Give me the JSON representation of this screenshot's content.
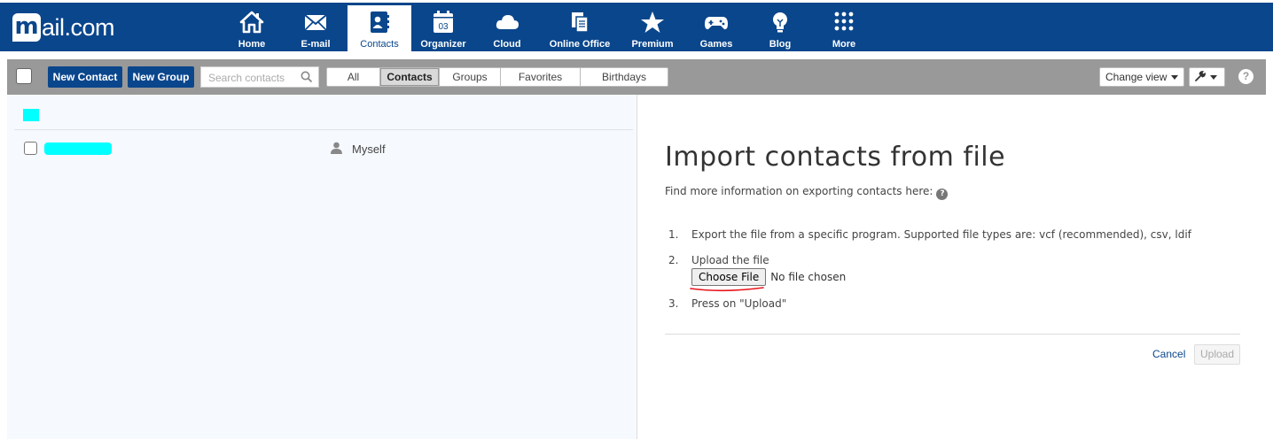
{
  "brand": {
    "logo_letter": "m",
    "logo_text": "ail.com"
  },
  "nav": [
    {
      "label": "Home",
      "icon": "home-icon"
    },
    {
      "label": "E-mail",
      "icon": "mail-icon"
    },
    {
      "label": "Contacts",
      "icon": "contacts-icon",
      "active": true
    },
    {
      "label": "Organizer",
      "icon": "calendar-icon",
      "badge": "03"
    },
    {
      "label": "Cloud",
      "icon": "cloud-icon"
    },
    {
      "label": "Online Office",
      "icon": "office-icon"
    },
    {
      "label": "Premium",
      "icon": "star-icon"
    },
    {
      "label": "Games",
      "icon": "gamepad-icon"
    },
    {
      "label": "Blog",
      "icon": "lightbulb-icon"
    },
    {
      "label": "More",
      "icon": "grid-icon"
    }
  ],
  "toolbar": {
    "new_contact": "New Contact",
    "new_group": "New Group",
    "search_placeholder": "Search contacts",
    "filters": [
      "All",
      "Contacts",
      "Groups",
      "Favorites",
      "Birthdays"
    ],
    "active_filter": "Contacts",
    "change_view": "Change view",
    "help": "?"
  },
  "contact_list": {
    "rows": [
      {
        "tag": "Myself"
      }
    ]
  },
  "import": {
    "title": "Import contacts from file",
    "info": "Find more information on exporting contacts here:",
    "steps": [
      {
        "num": "1.",
        "text": "Export the file from a specific program. Supported file types are: vcf (recommended), csv, ldif"
      },
      {
        "num": "2.",
        "text": "Upload the file"
      },
      {
        "num": "3.",
        "text": "Press on \"Upload\""
      }
    ],
    "choose_file": "Choose File",
    "file_status": "No file chosen",
    "cancel": "Cancel",
    "upload": "Upload"
  },
  "colors": {
    "brand_blue": "#0a468c",
    "toolbar_gray": "#999999",
    "annotation_red": "#e8141b",
    "redaction_cyan": "#00ffff"
  }
}
